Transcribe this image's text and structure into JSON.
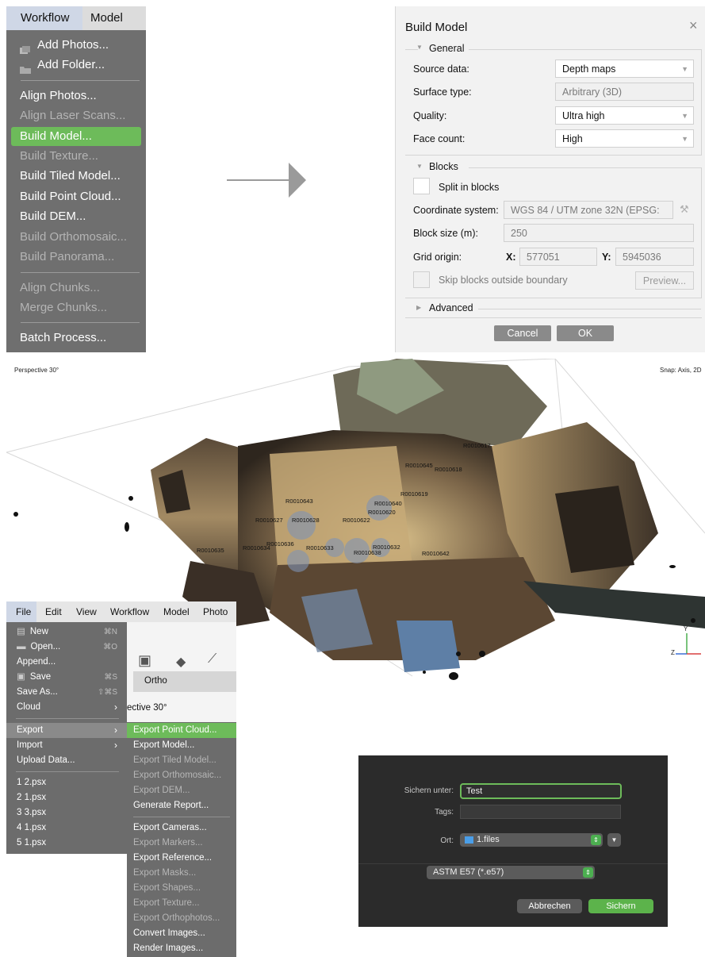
{
  "workflow_menu": {
    "menubar": [
      "Workflow",
      "Model"
    ],
    "items": [
      {
        "label": "Add Photos...",
        "icon": "photos-icon",
        "state": "enabled"
      },
      {
        "label": "Add Folder...",
        "icon": "folder-icon",
        "state": "enabled"
      },
      {
        "label": "Align Photos...",
        "state": "enabled"
      },
      {
        "label": "Align Laser Scans...",
        "state": "disabled"
      },
      {
        "label": "Build Model...",
        "state": "highlighted"
      },
      {
        "label": "Build Texture...",
        "state": "disabled"
      },
      {
        "label": "Build Tiled Model...",
        "state": "enabled"
      },
      {
        "label": "Build Point Cloud...",
        "state": "enabled"
      },
      {
        "label": "Build DEM...",
        "state": "enabled"
      },
      {
        "label": "Build Orthomosaic...",
        "state": "disabled"
      },
      {
        "label": "Build Panorama...",
        "state": "disabled"
      },
      {
        "label": "Align Chunks...",
        "state": "disabled"
      },
      {
        "label": "Merge Chunks...",
        "state": "disabled"
      },
      {
        "label": "Batch Process...",
        "state": "enabled"
      }
    ]
  },
  "build_model_dialog": {
    "title": "Build Model",
    "general_section": "General",
    "source_data_label": "Source data:",
    "source_data_value": "Depth maps",
    "surface_type_label": "Surface type:",
    "surface_type_value": "Arbitrary (3D)",
    "quality_label": "Quality:",
    "quality_value": "Ultra high",
    "face_count_label": "Face count:",
    "face_count_value": "High",
    "blocks_section": "Blocks",
    "split_label": "Split in blocks",
    "coord_label": "Coordinate system:",
    "coord_value": "WGS 84 / UTM zone 32N (EPSG:",
    "block_size_label": "Block size (m):",
    "block_size_value": "250",
    "grid_origin_label": "Grid origin:",
    "x_label": "X:",
    "x_value": "577051",
    "y_label": "Y:",
    "y_value": "5945036",
    "skip_label": "Skip blocks outside boundary",
    "preview_label": "Preview...",
    "advanced_section": "Advanced",
    "cancel_label": "Cancel",
    "ok_label": "OK"
  },
  "viewport": {
    "perspective_label": "Perspective 30°",
    "snap_label": "Snap: Axis, 2D",
    "axis_y": "Y",
    "axis_z": "Z",
    "cameras": [
      "R0010617",
      "R0010645",
      "R0010618",
      "R0010643",
      "R0010619",
      "R0010640",
      "R0010620",
      "R0010622",
      "R0010627",
      "R0010628",
      "R0010636",
      "R0010633",
      "R0010632",
      "R0010642",
      "R0010638",
      "R0010634",
      "R0010635"
    ]
  },
  "file_menu": {
    "menubar": [
      "File",
      "Edit",
      "View",
      "Workflow",
      "Model",
      "Photo"
    ],
    "ortho_tab": "Ortho",
    "perspective_partial": "ective 30°",
    "items": [
      {
        "label": "New",
        "shortcut": "⌘N"
      },
      {
        "label": "Open...",
        "shortcut": "⌘O"
      },
      {
        "label": "Append...",
        "shortcut": ""
      },
      {
        "label": "Save",
        "shortcut": "⌘S"
      },
      {
        "label": "Save As...",
        "shortcut": "⇧⌘S"
      },
      {
        "label": "Cloud",
        "shortcut": "›"
      },
      {
        "label": "Export",
        "shortcut": "›"
      },
      {
        "label": "Import",
        "shortcut": "›"
      },
      {
        "label": "Upload Data...",
        "shortcut": ""
      },
      {
        "label": "1 2.psx",
        "shortcut": ""
      },
      {
        "label": "2 1.psx",
        "shortcut": ""
      },
      {
        "label": "3 3.psx",
        "shortcut": ""
      },
      {
        "label": "4 1.psx",
        "shortcut": ""
      },
      {
        "label": "5 1.psx",
        "shortcut": ""
      }
    ],
    "export_items": [
      {
        "label": "Export Point Cloud...",
        "state": "highlighted"
      },
      {
        "label": "Export Model...",
        "state": "enabled"
      },
      {
        "label": "Export Tiled Model...",
        "state": "disabled"
      },
      {
        "label": "Export Orthomosaic...",
        "state": "disabled"
      },
      {
        "label": "Export DEM...",
        "state": "disabled"
      },
      {
        "label": "Generate Report...",
        "state": "enabled"
      },
      {
        "label": "Export Cameras...",
        "state": "enabled"
      },
      {
        "label": "Export Markers...",
        "state": "disabled"
      },
      {
        "label": "Export Reference...",
        "state": "enabled"
      },
      {
        "label": "Export Masks...",
        "state": "disabled"
      },
      {
        "label": "Export Shapes...",
        "state": "disabled"
      },
      {
        "label": "Export Texture...",
        "state": "disabled"
      },
      {
        "label": "Export Orthophotos...",
        "state": "disabled"
      },
      {
        "label": "Convert Images...",
        "state": "enabled"
      },
      {
        "label": "Render Images...",
        "state": "enabled"
      }
    ]
  },
  "save_dialog": {
    "save_as_label": "Sichern unter:",
    "save_as_value": "Test",
    "tags_label": "Tags:",
    "location_label": "Ort:",
    "location_value": "1.files",
    "format_value": "ASTM E57 (*.e57)",
    "cancel_label": "Abbrechen",
    "save_label": "Sichern"
  },
  "colors": {
    "highlight_green": "#6dbb5a",
    "menu_gray": "#6f6f6f",
    "dialog_bg": "#f2f2f2",
    "save_dialog_bg": "#2b2b2b"
  }
}
